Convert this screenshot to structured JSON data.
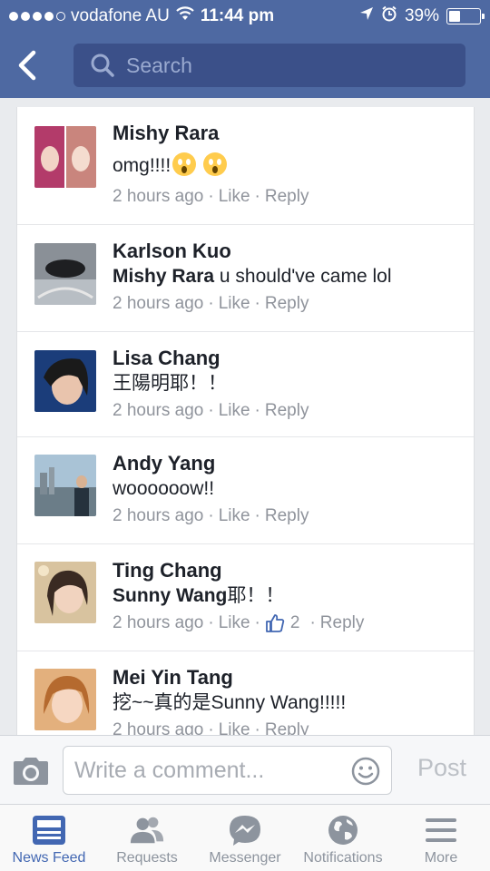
{
  "status_bar": {
    "carrier": "vodafone AU",
    "time": "11:44 pm",
    "battery": "39%",
    "battery_level": 0.39
  },
  "nav": {
    "search_placeholder": "Search"
  },
  "comments": [
    {
      "author": "Mishy Rara",
      "text": "omg!!!!",
      "time": "2 hours ago",
      "like": "Like",
      "reply": "Reply"
    },
    {
      "author": "Karlson Kuo",
      "mention": "Mishy Rara",
      "text": " u should've came lol",
      "time": "2 hours ago",
      "like": "Like",
      "reply": "Reply"
    },
    {
      "author": "Lisa Chang",
      "text": "王陽明耶！！",
      "time": "2 hours ago",
      "like": "Like",
      "reply": "Reply"
    },
    {
      "author": "Andy Yang",
      "text": "woooooow!!",
      "time": "2 hours ago",
      "like": "Like",
      "reply": "Reply"
    },
    {
      "author": "Ting Chang",
      "mention": "Sunny Wang",
      "text": "耶！！",
      "time": "2 hours ago",
      "like": "Like",
      "like_count": "2",
      "reply": "Reply"
    },
    {
      "author": "Mei Yin Tang",
      "text": "挖~~真的是Sunny Wang!!!!!",
      "time": "2 hours ago",
      "like": "Like",
      "reply": "Reply"
    }
  ],
  "compose": {
    "placeholder": "Write a comment...",
    "post_label": "Post"
  },
  "tabs": [
    {
      "label": "News Feed",
      "icon": "news-feed-icon",
      "active": true
    },
    {
      "label": "Requests",
      "icon": "friends-icon",
      "active": false
    },
    {
      "label": "Messenger",
      "icon": "messenger-icon",
      "active": false
    },
    {
      "label": "Notifications",
      "icon": "globe-icon",
      "active": false
    },
    {
      "label": "More",
      "icon": "menu-icon",
      "active": false
    }
  ],
  "colors": {
    "brand": "#4e69a2",
    "search_bg": "#3b5089",
    "active_tab": "#4267b2",
    "meta_gray": "#90949c"
  }
}
